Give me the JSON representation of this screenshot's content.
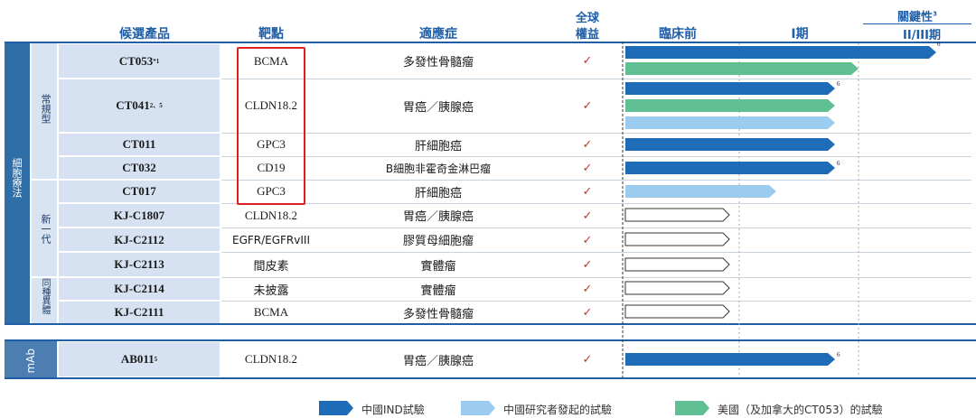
{
  "headers": {
    "candidate": "候選產品",
    "target": "靶點",
    "indication": "適應症",
    "global_rights": [
      "全球",
      "權益"
    ],
    "preclinical": "臨床前",
    "phase1": "I期",
    "pivotal": "關鍵性",
    "pivotal_sup": "3",
    "phase23": "II/III期"
  },
  "side_labels": {
    "cell_therapy": "細胞療法",
    "autologous": "常規型",
    "new_gen": "新一代",
    "allogeneic": "同種異體",
    "mab": "mAb"
  },
  "rows": [
    {
      "candidate": "CT053",
      "sup": "*1",
      "target": "BCMA",
      "indication": "多發性骨髓瘤",
      "check": "✓"
    },
    {
      "candidate": "CT041",
      "sup": "2、5",
      "target": "CLDN18.2",
      "indication": "胃癌／胰腺癌",
      "check": "✓"
    },
    {
      "candidate": "CT011",
      "sup": "",
      "target": "GPC3",
      "indication": "肝細胞癌",
      "check": "✓"
    },
    {
      "candidate": "CT032",
      "sup": "",
      "target": "CD19",
      "indication": "B細胞非霍奇金淋巴瘤",
      "check": "✓"
    },
    {
      "candidate": "CT017",
      "sup": "",
      "target": "GPC3",
      "indication": "肝細胞癌",
      "check": "✓"
    },
    {
      "candidate": "KJ-C1807",
      "sup": "",
      "target": "CLDN18.2",
      "indication": "胃癌／胰腺癌",
      "check": "✓"
    },
    {
      "candidate": "KJ-C2112",
      "sup": "",
      "target": "EGFR/EGFRvIII",
      "indication": "膠質母細胞瘤",
      "check": "✓"
    },
    {
      "candidate": "KJ-C2113",
      "sup": "",
      "target": "間皮素",
      "indication": "實體瘤",
      "check": "✓"
    },
    {
      "candidate": "KJ-C2114",
      "sup": "",
      "target": "未披露",
      "indication": "實體瘤",
      "check": "✓"
    },
    {
      "candidate": "KJ-C2111",
      "sup": "",
      "target": "BCMA",
      "indication": "多發性骨髓瘤",
      "check": "✓"
    },
    {
      "candidate": "AB011",
      "sup": "5",
      "target": "CLDN18.2",
      "indication": "胃癌／胰腺癌",
      "check": "✓"
    }
  ],
  "bar_notes": [
    "6",
    "6",
    "6",
    "6"
  ],
  "legend": {
    "china_ind": "中國IND試驗",
    "iit": "中國研究者發起的試驗",
    "us": "美國（及加拿大的CT053）的試驗"
  },
  "colors": {
    "china_ind": "#1e6bb8",
    "iit": "#9ccbf0",
    "us": "#5fbf93",
    "header_text": "#1f5fa8",
    "highlight": "#e02020"
  }
}
